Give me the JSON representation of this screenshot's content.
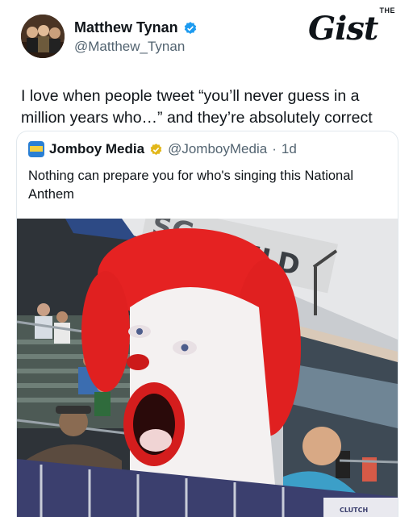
{
  "author": {
    "name": "Matthew Tynan",
    "handle": "@Matthew_Tynan",
    "verified_icon": "verified-badge-icon",
    "verified_color": "#1d9bf0"
  },
  "brand": {
    "the": "THE",
    "word": "Gist"
  },
  "tweet": {
    "text": "I love when people tweet “you’ll never guess in a million years who…” and they’re absolutely correct"
  },
  "quoted": {
    "name": "Jomboy Media",
    "handle": "@JomboyMedia",
    "separator": "·",
    "time": "1d",
    "badge_icon": "gold-verified-badge-icon",
    "badge_color": "#e2b719",
    "text": "Nothing can prepare you for who's singing this National Anthem",
    "media": {
      "sign_text": "FIELD",
      "sign_partial": "SG",
      "banner_text": "CLUTCH"
    }
  }
}
